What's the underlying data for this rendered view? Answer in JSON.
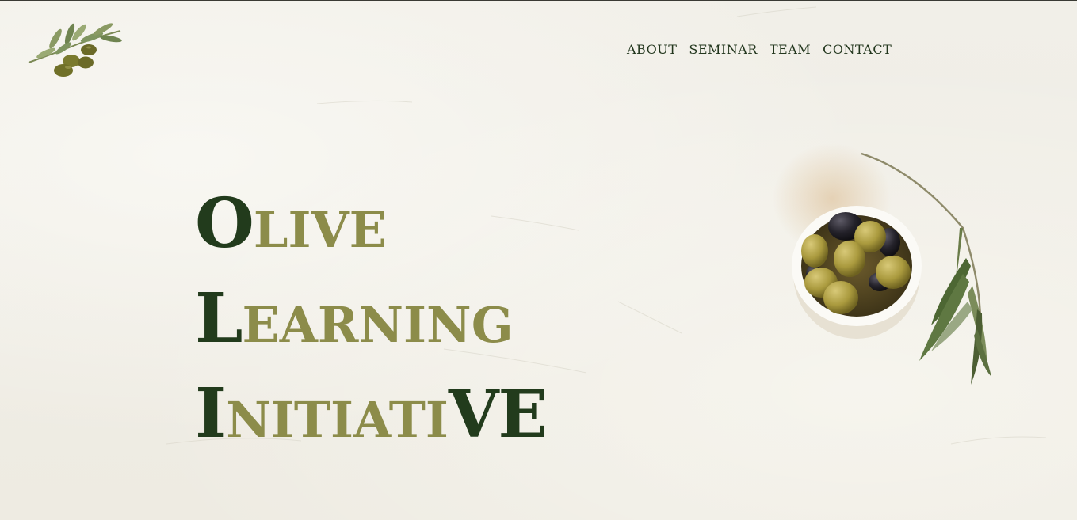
{
  "nav": {
    "items": [
      {
        "label": "ABOUT",
        "name": "nav-about"
      },
      {
        "label": "SEMINAR",
        "name": "nav-seminar"
      },
      {
        "label": "TEAM",
        "name": "nav-team"
      },
      {
        "label": "CONTACT",
        "name": "nav-contact"
      }
    ]
  },
  "hero": {
    "line1": {
      "cap": "O",
      "rest": "LIVE"
    },
    "line2": {
      "cap": "L",
      "rest": "EARNING"
    },
    "line3": {
      "cap": "I",
      "middle": "NITIATI",
      "end": "VE"
    }
  },
  "colors": {
    "dark_green": "#223b1c",
    "olive": "#8c8c4a",
    "background": "#efece4"
  },
  "icons": {
    "logo": "olive-branch-icon",
    "decoration": "olive-bowl-image"
  }
}
